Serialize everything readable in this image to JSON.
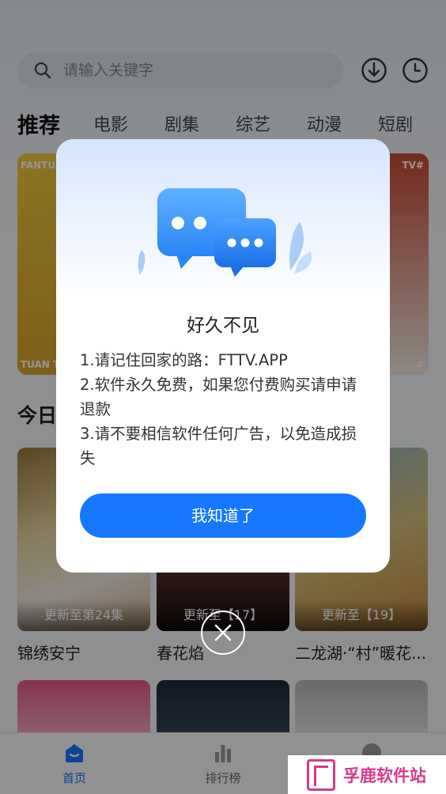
{
  "search": {
    "placeholder": "请输入关键字"
  },
  "top_icons": [
    "download-icon",
    "history-clock-icon"
  ],
  "tabs": [
    {
      "label": "推荐",
      "active": true
    },
    {
      "label": "电影"
    },
    {
      "label": "剧集"
    },
    {
      "label": "综艺"
    },
    {
      "label": "动漫"
    },
    {
      "label": "短剧"
    }
  ],
  "banner": {
    "tag_left": "FANTUA",
    "tag_right": "TV#",
    "tag_left_bottom": "TUAN TV",
    "tag_right_bottom": "#"
  },
  "section": {
    "title": "今日"
  },
  "cards": [
    {
      "title": "锦绣安宁",
      "caption": "更新至第24集"
    },
    {
      "title": "春花焰",
      "caption": "更新至【17】"
    },
    {
      "title": "二龙湖·“村”暖花...",
      "caption": "更新至【19】"
    }
  ],
  "dialog": {
    "title": "好久不见",
    "lines": [
      "1.请记住回家的路：FTTV.APP",
      "2.软件永久免费，如果您付费购买请申请退款",
      "3.请不要相信软件任何广告，以免造成损失"
    ],
    "ok_label": "我知道了"
  },
  "bottom_nav": [
    {
      "label": "首页",
      "icon": "home-icon",
      "active": true
    },
    {
      "label": "排行榜",
      "icon": "rank-chart-icon"
    },
    {
      "label": "",
      "icon": "profile-icon"
    }
  ],
  "watermark": {
    "text": "孚鹿软件站"
  },
  "colors": {
    "accent": "#1677ff",
    "watermark": "#d83a8a"
  }
}
